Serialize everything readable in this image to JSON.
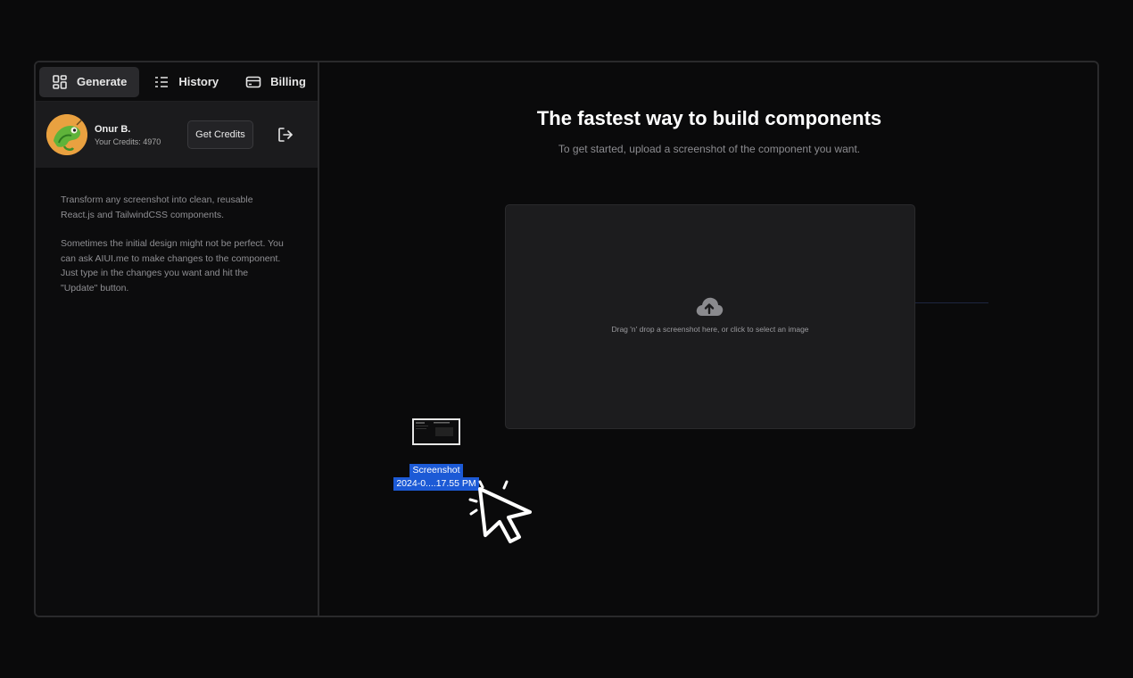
{
  "nav": {
    "tabs": [
      {
        "label": "Generate",
        "icon": "dashboard-icon",
        "active": true
      },
      {
        "label": "History",
        "icon": "list-icon",
        "active": false
      },
      {
        "label": "Billing",
        "icon": "credit-card-icon",
        "active": false
      }
    ]
  },
  "profile": {
    "name": "Onur B.",
    "credits_text": "Your Credits: 4970",
    "get_credits_label": "Get Credits",
    "logout_icon": "logout-icon"
  },
  "intro": {
    "paragraph_1": "Transform any screenshot into clean, reusable React.js and TailwindCSS components.",
    "paragraph_2": "Sometimes the initial design might not be perfect. You can ask AIUI.me to make changes to the component. Just type in the changes you want and hit the \"Update\" button."
  },
  "main": {
    "title": "The fastest way to build components",
    "subtitle": "To get started, upload a screenshot of the component you want.",
    "dropzone_text": "Drag 'n' drop a screenshot here, or click to select an image",
    "dropzone_icon": "cloud-upload-icon"
  },
  "drag": {
    "file_label_line1": "Screenshot",
    "file_label_line2": "2024-0....17.55 PM"
  },
  "colors": {
    "background": "#0a0a0b",
    "panel": "#1b1b1d",
    "selection": "#1c5ad6",
    "muted_text": "#8f8f93"
  }
}
